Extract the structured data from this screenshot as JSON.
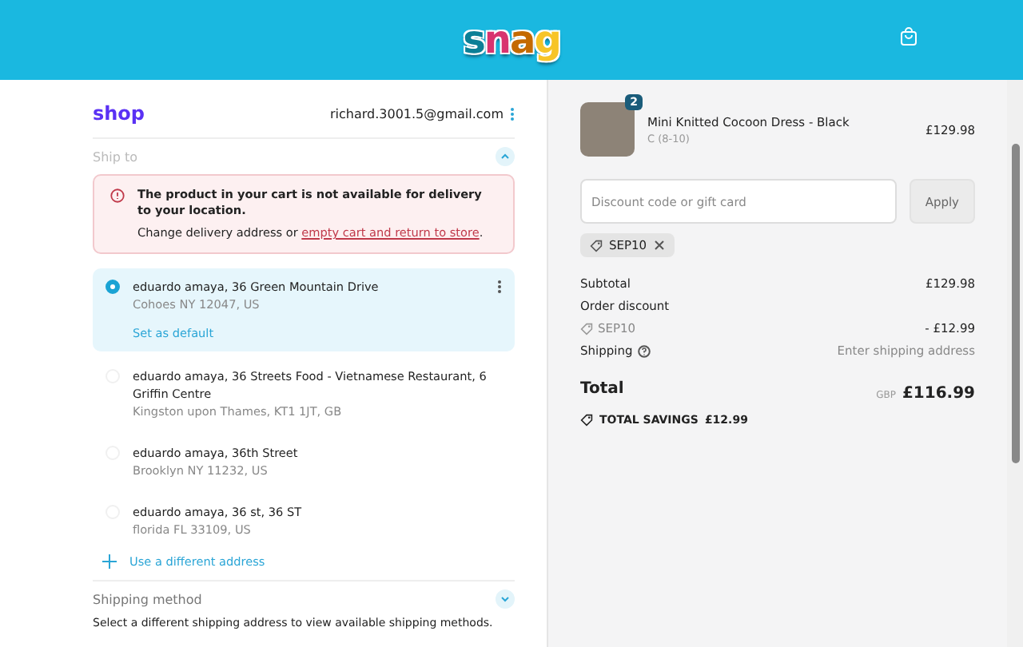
{
  "header": {
    "logo": "snag"
  },
  "account": {
    "brand": "shop",
    "email": "richard.3001.5@gmail.com"
  },
  "ship_to": {
    "label": "Ship to",
    "expanded": true
  },
  "alert": {
    "title": "The product in your cart is not available for delivery to your location.",
    "text": "Change delivery address or ",
    "link": "empty cart and return to store",
    "end": "."
  },
  "addresses": [
    {
      "line1": "eduardo amaya, 36 Green Mountain Drive",
      "line2": "Cohoes NY 12047, US",
      "action": "Set as default",
      "selected": true
    },
    {
      "line1": "eduardo amaya, 36 Streets Food - Vietnamese Restaurant, 6 Griffin Centre",
      "line2": "Kingston upon Thames, KT1 1JT, GB",
      "selected": false
    },
    {
      "line1": "eduardo amaya, 36th Street",
      "line2": "Brooklyn NY 11232, US",
      "selected": false
    },
    {
      "line1": "eduardo amaya, 36 st, 36 ST",
      "line2": "florida FL 33109, US",
      "selected": false
    }
  ],
  "new_address": "Use a different address",
  "shipping_method": {
    "label": "Shipping method",
    "expanded": false,
    "note": "Select a different shipping address to view available shipping methods."
  },
  "product": {
    "name": "Mini Knitted Cocoon Dress - Black",
    "variant": "C (8-10)",
    "price": "£129.98",
    "quantity": "2"
  },
  "discount": {
    "placeholder": "Discount code or gift card",
    "button": "Apply",
    "tag": "SEP10"
  },
  "summary": [
    {
      "label": "Subtotal",
      "value": "£129.98"
    },
    {
      "label": "Order discount"
    },
    {
      "label": "SEP10",
      "value": "- £12.99",
      "kind": "code"
    },
    {
      "label": "Shipping",
      "value": "Enter shipping address",
      "kind": "info"
    }
  ],
  "total": {
    "label": "Total",
    "currency": "GBP",
    "value": "£116.99"
  },
  "savings": {
    "label": "TOTAL SAVINGS",
    "value": "£12.99"
  }
}
